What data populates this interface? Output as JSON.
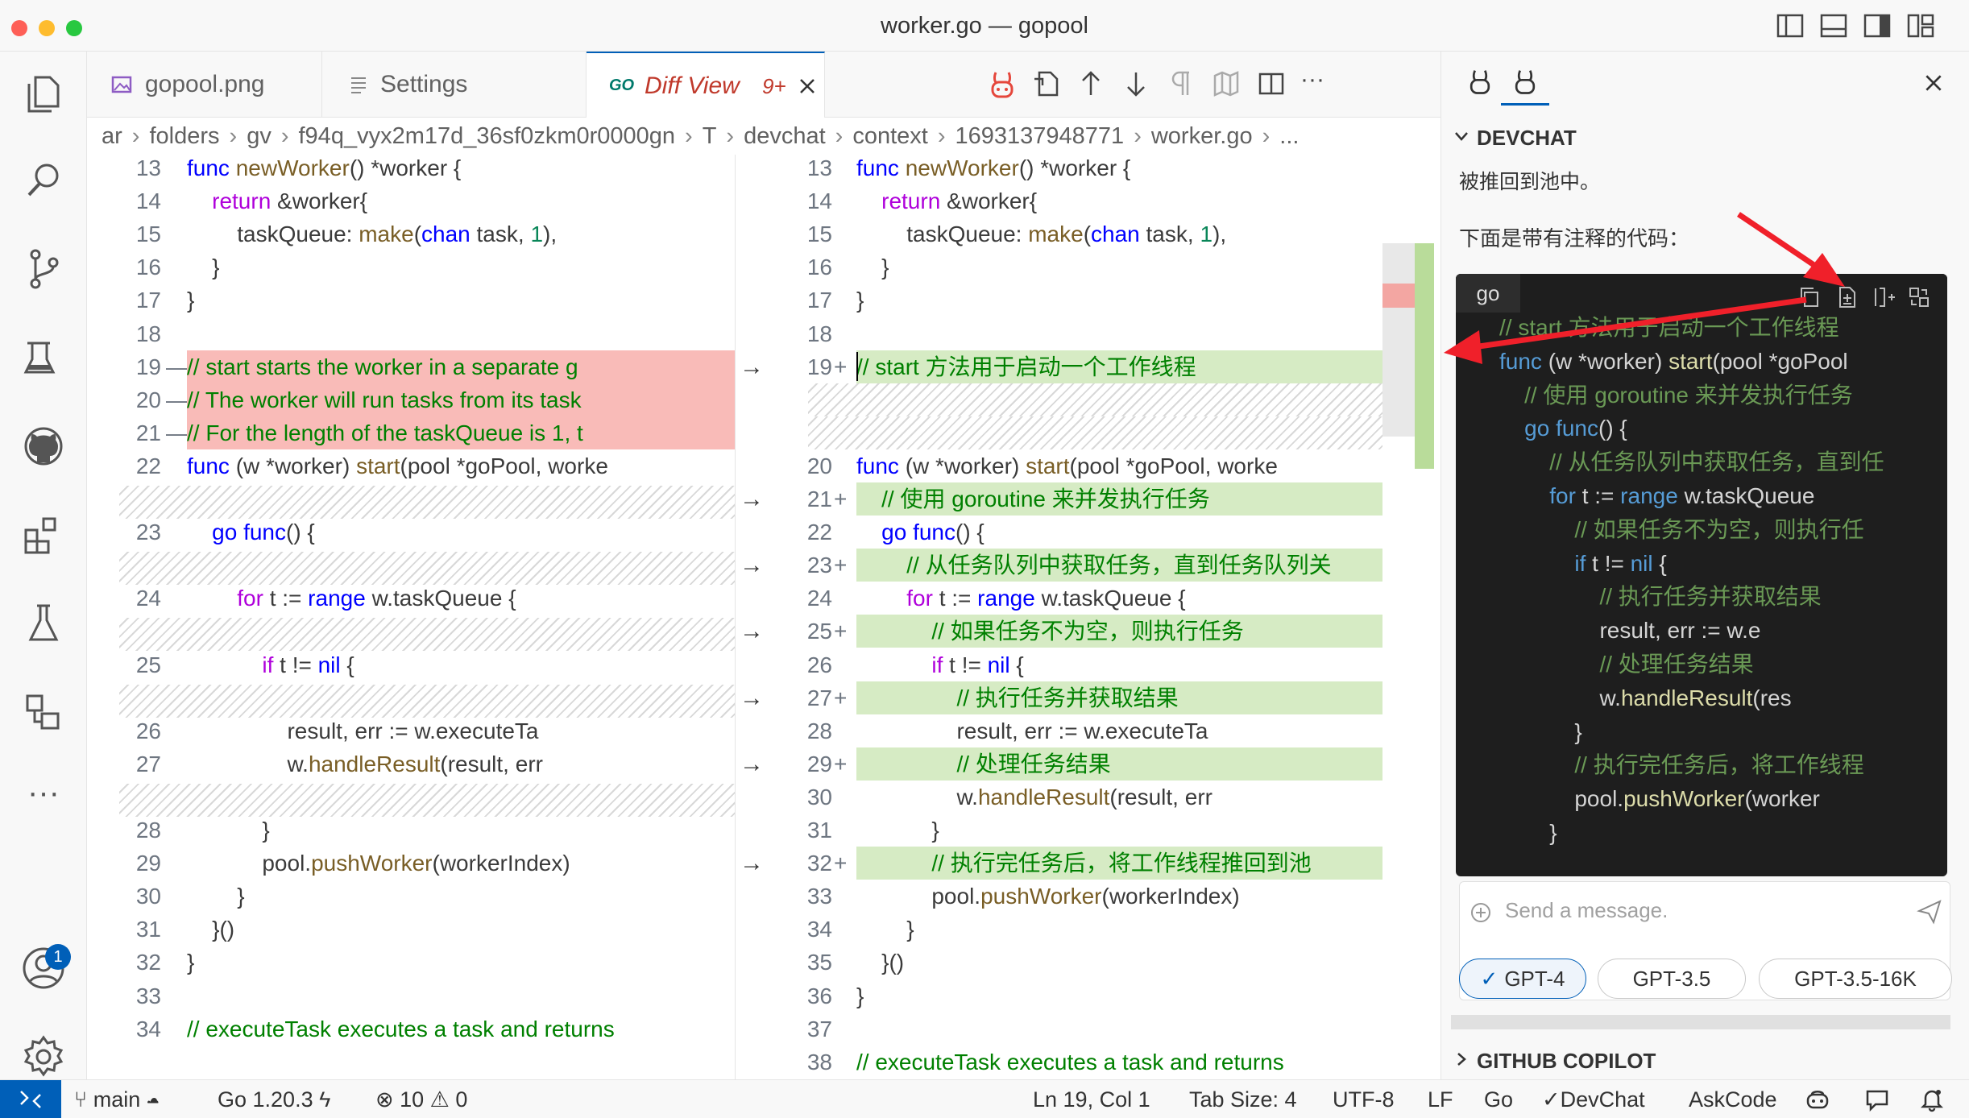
{
  "window": {
    "title": "worker.go — gopool"
  },
  "tabs": [
    {
      "label": "gopool.png",
      "icon": "image-icon"
    },
    {
      "label": "Settings",
      "icon": "settings-file-icon"
    },
    {
      "label": "Diff View",
      "badge": "9+",
      "icon": "go-file-icon",
      "lang": "GO"
    }
  ],
  "breadcrumb": [
    "ar",
    "folders",
    "gv",
    "f94q_vyx2m17d_36sf0zkm0r0000gn",
    "T",
    "devchat",
    "context",
    "1693137948771",
    "worker.go",
    "..."
  ],
  "diff_left": [
    {
      "n": "13",
      "t": "func newWorker() *worker {"
    },
    {
      "n": "14",
      "t": "    return &worker{"
    },
    {
      "n": "15",
      "t": "        taskQueue: make(chan task, 1),"
    },
    {
      "n": "16",
      "t": "    }"
    },
    {
      "n": "17",
      "t": "}"
    },
    {
      "n": "18",
      "t": ""
    },
    {
      "n": "19",
      "t": "// start starts the worker in a separate g"
    },
    {
      "n": "20",
      "t": "// The worker will run tasks from its task"
    },
    {
      "n": "21",
      "t": "// For the length of the taskQueue is 1, t"
    },
    {
      "n": "22",
      "t": "func (w *worker) start(pool *goPool, worke"
    },
    {
      "n": "23",
      "t": "    go func() {"
    },
    {
      "n": "24",
      "t": "        for t := range w.taskQueue {"
    },
    {
      "n": "25",
      "t": "            if t != nil {"
    },
    {
      "n": "26",
      "t": "                result, err := w.executeTa"
    },
    {
      "n": "27",
      "t": "                w.handleResult(result, err"
    },
    {
      "n": "28",
      "t": "            }"
    },
    {
      "n": "29",
      "t": "            pool.pushWorker(workerIndex)"
    },
    {
      "n": "30",
      "t": "        }"
    },
    {
      "n": "31",
      "t": "    }()"
    },
    {
      "n": "32",
      "t": "}"
    },
    {
      "n": "33",
      "t": ""
    },
    {
      "n": "34",
      "t": "// executeTask executes a task and returns"
    }
  ],
  "diff_right": [
    {
      "n": "13",
      "t": "func newWorker() *worker {"
    },
    {
      "n": "14",
      "t": "    return &worker{"
    },
    {
      "n": "15",
      "t": "        taskQueue: make(chan task, 1),"
    },
    {
      "n": "16",
      "t": "    }"
    },
    {
      "n": "17",
      "t": "}"
    },
    {
      "n": "18",
      "t": ""
    },
    {
      "n": "19",
      "t": "// start 方法用于启动一个工作线程"
    },
    {
      "n": "20",
      "t": "func (w *worker) start(pool *goPool, worke"
    },
    {
      "n": "21",
      "t": "    // 使用 goroutine 来并发执行任务"
    },
    {
      "n": "22",
      "t": "    go func() {"
    },
    {
      "n": "23",
      "t": "        // 从任务队列中获取任务，直到任务队列关"
    },
    {
      "n": "24",
      "t": "        for t := range w.taskQueue {"
    },
    {
      "n": "25",
      "t": "            // 如果任务不为空，则执行任务"
    },
    {
      "n": "26",
      "t": "            if t != nil {"
    },
    {
      "n": "27",
      "t": "                // 执行任务并获取结果"
    },
    {
      "n": "28",
      "t": "                result, err := w.executeTa"
    },
    {
      "n": "29",
      "t": "                // 处理任务结果"
    },
    {
      "n": "30",
      "t": "                w.handleResult(result, err"
    },
    {
      "n": "31",
      "t": "            }"
    },
    {
      "n": "32",
      "t": "            // 执行完任务后，将工作线程推回到池"
    },
    {
      "n": "33",
      "t": "            pool.pushWorker(workerIndex)"
    },
    {
      "n": "34",
      "t": "        }"
    },
    {
      "n": "35",
      "t": "    }()"
    },
    {
      "n": "36",
      "t": "}"
    },
    {
      "n": "37",
      "t": ""
    },
    {
      "n": "38",
      "t": "// executeTask executes a task and returns"
    }
  ],
  "chat": {
    "section_title": "DEVCHAT",
    "prev_text": "被推回到池中。",
    "intro_text": "下面是带有注释的代码：",
    "code_lang": "go",
    "code_lines": [
      "// start 方法用于启动一个工作线程",
      "func (w *worker) start(pool *goPool",
      "    // 使用 goroutine 来并发执行任务",
      "    go func() {",
      "        // 从任务队列中获取任务，直到任",
      "        for t := range w.taskQueue",
      "            // 如果任务不为空，则执行任",
      "            if t != nil {",
      "                // 执行任务并获取结果",
      "                result, err := w.e",
      "                // 处理任务结果",
      "                w.handleResult(res",
      "            }",
      "            // 执行完任务后，将工作线程",
      "            pool.pushWorker(worker",
      "        }"
    ],
    "input_placeholder": "Send a message.",
    "models": [
      "GPT-4",
      "GPT-3.5",
      "GPT-3.5-16K"
    ],
    "selected_model": "GPT-4",
    "copilot_title": "GITHUB COPILOT"
  },
  "status": {
    "branch": "main",
    "go_version": "Go 1.20.3",
    "errors": "10",
    "warnings": "0",
    "cursor": "Ln 19, Col 1",
    "tab_size": "Tab Size: 4",
    "encoding": "UTF-8",
    "eol": "LF",
    "language": "Go",
    "devchat": "DevChat",
    "askcode": "AskCode"
  },
  "accounts_badge": "1",
  "colors": {
    "accent": "#005fb8",
    "deleted": "#f9bbb8",
    "inserted": "#d6ebc4",
    "annotation": "#f0202a"
  }
}
